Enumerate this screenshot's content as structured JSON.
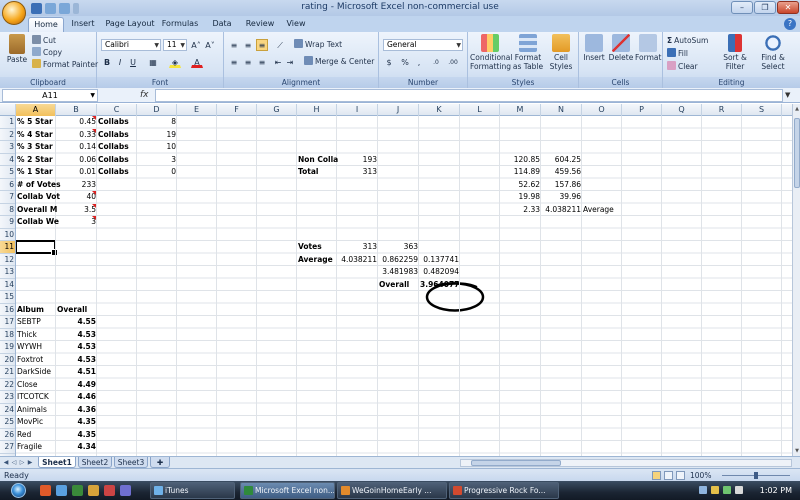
{
  "window": {
    "title": "rating - Microsoft Excel non-commercial use",
    "controls": {
      "minimize": "–",
      "restore": "❐",
      "close": "✕"
    }
  },
  "ribbon": {
    "tabs": [
      "Home",
      "Insert",
      "Page Layout",
      "Formulas",
      "Data",
      "Review",
      "View"
    ],
    "active_tab": "Home",
    "clipboard": {
      "paste": "Paste",
      "cut": "Cut",
      "copy": "Copy",
      "format_painter": "Format Painter",
      "label": "Clipboard"
    },
    "font": {
      "name": "Calibri",
      "size": "11",
      "grow": "A˄",
      "shrink": "A˅",
      "bold": "B",
      "italic": "I",
      "underline": "U",
      "borders": "▦",
      "fill": "◈",
      "color": "A",
      "label": "Font"
    },
    "alignment": {
      "wrap": "Wrap Text",
      "merge": "Merge & Center",
      "label": "Alignment"
    },
    "number": {
      "format": "General",
      "currency": "$",
      "percent": "%",
      "comma": ",",
      "inc_dec": ".0",
      "dec_dec": ".00",
      "label": "Number"
    },
    "styles": {
      "conditional": "Conditional Formatting",
      "table": "Format as Table",
      "cell": "Cell Styles",
      "label": "Styles"
    },
    "cells": {
      "insert": "Insert",
      "delete": "Delete",
      "format": "Format",
      "label": "Cells"
    },
    "editing": {
      "autosum": "AutoSum",
      "fill": "Fill",
      "clear": "Clear",
      "sort": "Sort & Filter",
      "find": "Find & Select",
      "label": "Editing"
    }
  },
  "formula_bar": {
    "name_box": "A11",
    "fx": "fx",
    "value": ""
  },
  "grid": {
    "columns": [
      "A",
      "B",
      "C",
      "D",
      "E",
      "F",
      "G",
      "H",
      "I",
      "J",
      "K",
      "L",
      "M",
      "N",
      "O",
      "P",
      "Q",
      "R",
      "S"
    ],
    "rows": [
      "1",
      "2",
      "3",
      "4",
      "5",
      "6",
      "7",
      "8",
      "9",
      "10",
      "11",
      "12",
      "13",
      "14",
      "15",
      "16",
      "17",
      "18",
      "19",
      "20",
      "21",
      "22",
      "23",
      "24",
      "25",
      "26",
      "27"
    ],
    "selected_col": "A",
    "selected_row": "11",
    "cells": {
      "A1": "% 5 Star",
      "B1": "0.45",
      "C1": "Collabs",
      "D1": "8",
      "A2": "% 4 Star",
      "B2": "0.33",
      "C2": "Collabs",
      "D2": "19",
      "A3": "% 3 Star",
      "B3": "0.14",
      "C3": "Collabs",
      "D3": "10",
      "A4": "% 2 Star",
      "B4": "0.06",
      "C4": "Collabs",
      "D4": "3",
      "A5": "% 1 Star",
      "B5": "0.01",
      "C5": "Collabs",
      "D5": "0",
      "A6": "# of Votes",
      "B6": "233",
      "A7": "Collab Vot",
      "B7": "40",
      "A8": "Overall M",
      "B8": "3.5",
      "A9": "Collab We",
      "B9": "3",
      "H4": "Non Colla",
      "I4": "193",
      "H5": "Total",
      "I5": "313",
      "M4": "120.85",
      "N4": "604.25",
      "M5": "114.89",
      "N5": "459.56",
      "M6": "52.62",
      "N6": "157.86",
      "M7": "19.98",
      "N7": "39.96",
      "M8": "2.33",
      "N8": "4.038211",
      "O8": "Average",
      "H11": "Votes",
      "I11": "313",
      "J11": "363",
      "H12": "Average",
      "I12": "4.038211",
      "J12": "0.862259",
      "K12": "0.137741",
      "J13": "3.481983",
      "K13": "0.482094",
      "J14": "Overall",
      "K14": "3.964077",
      "A16": "Album",
      "B16": "Overall",
      "A17": "SEBTP",
      "B17": "4.55",
      "A18": "Thick",
      "B18": "4.53",
      "A19": "WYWH",
      "B19": "4.53",
      "A20": "Foxtrot",
      "B20": "4.53",
      "A21": "DarkSide",
      "B21": "4.51",
      "A22": "Close",
      "B22": "4.49",
      "A23": "ITCOTCK",
      "B23": "4.46",
      "A24": "Animals",
      "B24": "4.36",
      "A25": "MovPic",
      "B25": "4.35",
      "A26": "Red",
      "B26": "4.35",
      "A27": "Fragile",
      "B27": "4.34"
    }
  },
  "sheets": [
    "Sheet1",
    "Sheet2",
    "Sheet3"
  ],
  "active_sheet": "Sheet1",
  "status": {
    "text": "Ready",
    "zoom": "100%",
    "zoom_level": 0.5
  },
  "taskbar": {
    "tasks": [
      {
        "label": "iTunes",
        "icon_color": "#6fb1e8"
      },
      {
        "label": "Microsoft Excel non...",
        "icon_color": "#2f8a3c"
      },
      {
        "label": "WeGoinHomeEarly ...",
        "icon_color": "#e28a2b"
      },
      {
        "label": "Progressive Rock Fo...",
        "icon_color": "#d24a2f"
      }
    ],
    "clock": "1:02 PM"
  },
  "colors": {
    "accent_selected": "#f2c05c",
    "ribbon": "#d7e4f4",
    "taskbar": "#1b2533",
    "circle": "#000000"
  }
}
